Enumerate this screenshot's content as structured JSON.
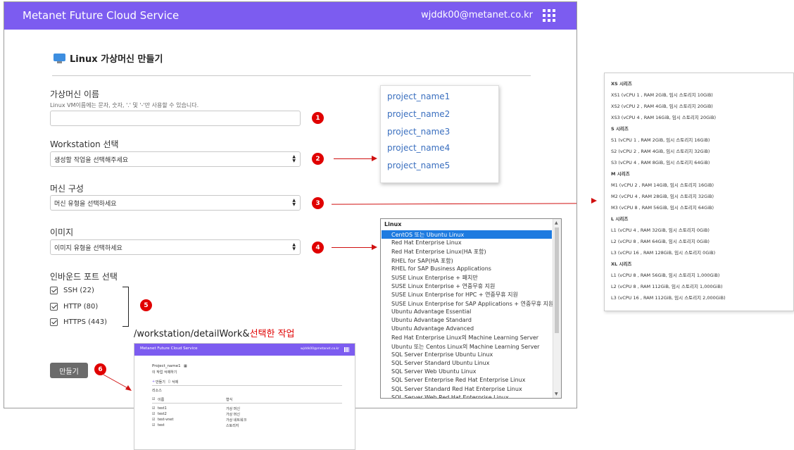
{
  "app": {
    "title": "Metanet Future Cloud Service",
    "user_email": "wjddk00@metanet.co.kr"
  },
  "page": {
    "title": "Linux 가상머신 만들기"
  },
  "form": {
    "vm_name": {
      "label": "가상머신 이름",
      "hint": "Linux VM이름에는 문자, 숫자, '.' 및 '-'만 사용할 수 있습니다.",
      "value": ""
    },
    "workstation": {
      "label": "Workstation 선택",
      "placeholder": "생성할 작업을 선택해주세요"
    },
    "machine": {
      "label": "머신 구성",
      "placeholder": "머신 유형을 선택하세요"
    },
    "image": {
      "label": "이미지",
      "placeholder": "이미지 유형을 선택하세요"
    },
    "inbound": {
      "label": "인바운드 포트 선택",
      "ports": [
        "SSH (22)",
        "HTTP (80)",
        "HTTPS (443)"
      ]
    },
    "create_button": "만들기"
  },
  "badges": [
    "1",
    "2",
    "3",
    "4",
    "5",
    "6"
  ],
  "project_list": [
    "project_name1",
    "project_name2",
    "project_name3",
    "project_name4",
    "project_name5"
  ],
  "image_list": {
    "group": "Linux",
    "items": [
      "CentOS 또는 Ubuntu Linux",
      "Red Hat Enterprise Linux",
      "Red Hat Enterprise Linux(HA 포함)",
      "RHEL for SAP(HA 포함)",
      "RHEL for SAP Business Applications",
      "SUSE Linux Enterprise + 패치만",
      "SUSE Linux Enterprise + 연중무휴 지원",
      "SUSE Linux Enterprise for HPC + 연중무휴 지원",
      "SUSE Linux Enterprise for SAP Applications + 연중무휴 지원",
      "Ubuntu Advantage Essential",
      "Ubuntu Advantage Standard",
      "Ubuntu Advantage Advanced",
      "Red Hat Enterprise Linux의 Machine Learning Server",
      "Ubuntu 또는 Centos Linux의 Machine Learning Server",
      "SQL Server Enterprise Ubuntu Linux",
      "SQL Server Standard Ubuntu Linux",
      "SQL Server Web Ubuntu Linux",
      "SQL Server Enterprise Red Hat Enterprise Linux",
      "SQL Server Standard Red Hat Enterprise Linux",
      "SQL Server Web Red Hat Enterprise Linux"
    ]
  },
  "series_list": [
    {
      "head": "XS 시리즈",
      "items": [
        "XS1 (vCPU 1 , RAM 2GiB, 임시 스토리지 10GiB)",
        "XS2 (vCPU 2 , RAM 4GiB, 임시 스토리지 20GiB)",
        "XS3 (vCPU 4 , RAM 16GiB, 임시 스토리지 20GiB)"
      ]
    },
    {
      "head": "S 시리즈",
      "items": [
        "S1 (vCPU 1 , RAM 2GiB, 임시 스토리지 16GiB)",
        "S2 (vCPU 2 , RAM 4GiB, 임시 스토리지 32GiB)",
        "S3 (vCPU 4 , RAM 8GiB, 임시 스토리지 64GiB)"
      ]
    },
    {
      "head": "M 시리즈",
      "items": [
        "M1 (vCPU 2 , RAM 14GiB, 임시 스토리지 16GiB)",
        "M2 (vCPU 4 , RAM 28GiB, 임시 스토리지 32GiB)",
        "M3 (vCPU 8 , RAM 56GiB, 임시 스토리지 64GiB)"
      ]
    },
    {
      "head": "L 시리즈",
      "items": [
        "L1 (vCPU 4 , RAM 32GiB, 임시 스토리지 0GiB)",
        "L2 (vCPU 8 , RAM 64GiB, 임시 스토리지 0GiB)",
        "L3 (vCPU 16 , RAM 128GiB, 임시 스토리지 0GiB)"
      ]
    },
    {
      "head": "XL 시리즈",
      "items": [
        "L1 (vCPU 8 , RAM 56GiB, 임시 스토리지 1,000GiB)",
        "L2 (vCPU 8 , RAM 112GiB, 임시 스토리지 1,000GiB)",
        "L3 (vCPU 16 , RAM 112GiB, 임시 스토리지 2,000GiB)"
      ]
    }
  ],
  "route": {
    "path": "/workstation/detailWork&",
    "highlight": "선택한 작업"
  },
  "detail": {
    "app_title": "Metanet Future Cloud Service",
    "email": "wjddk00@metanet.co.kr",
    "project": "Project_name1",
    "delete_project": "이 작업 삭제하기",
    "create": "만들기",
    "remove": "삭제",
    "section": "리소스",
    "col_name": "이름",
    "col_type": "형식",
    "rows": [
      {
        "name": "test1",
        "type": "가상 머신"
      },
      {
        "name": "test2",
        "type": "가상 머신"
      },
      {
        "name": "test-vnet",
        "type": "가상 네트워크"
      },
      {
        "name": "test",
        "type": "스토리지"
      }
    ]
  },
  "colors": {
    "brand": "#7c5cf0",
    "badge": "#e00000",
    "link": "#3a6fbf",
    "selected": "#1e7be0"
  }
}
